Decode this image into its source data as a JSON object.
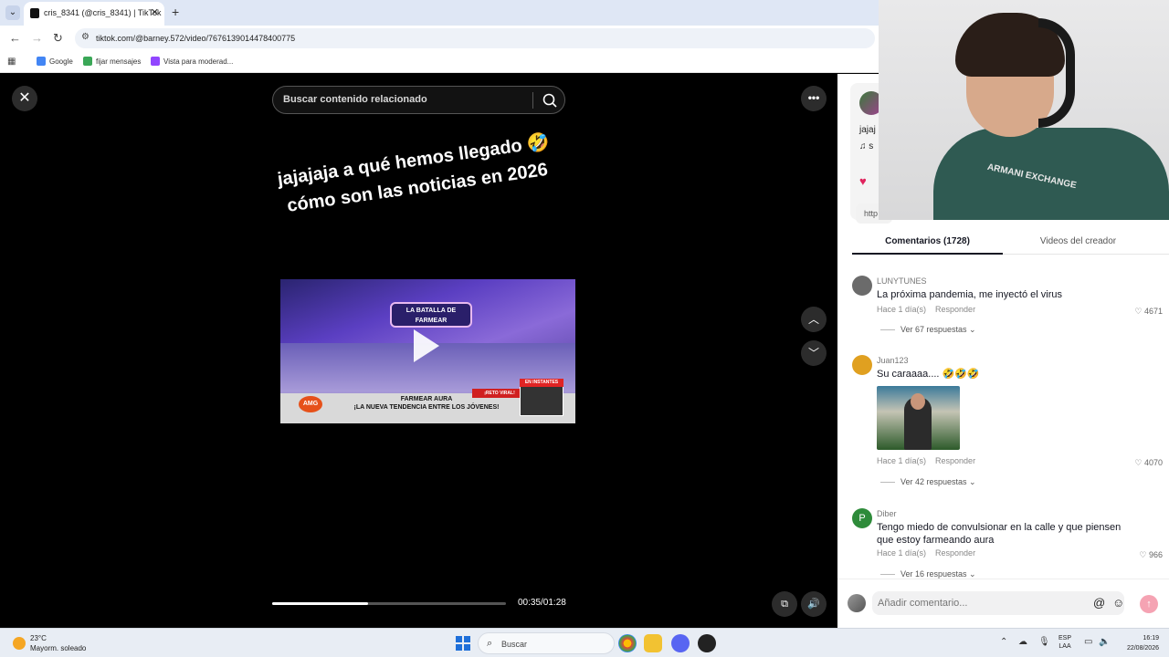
{
  "browser": {
    "tab_title": "cris_8341 (@cris_8341) | TikTok",
    "url": "tiktok.com/@barney.572/video/7676139014478400775",
    "bookmarks": [
      "Google",
      "fijar mensajes",
      "Vista para moderad..."
    ]
  },
  "video": {
    "search_placeholder": "Buscar contenido relacionado",
    "caption": "jajajaja a qué hemos llegado 🤣 cómo son las noticias en 2026",
    "thumbnail": {
      "top_logo": "LA BATALLA DE FARMEAR",
      "banner_logo": "AMG",
      "banner_title_line1": "FARMEAR AURA",
      "banner_title_line2": "¡LA NUEVA TENDENCIA ENTRE LOS JÓVENES!",
      "badge": "EN INSTANTES",
      "reto": "¡RETO VIRAL!"
    },
    "progress_fraction": 0.41,
    "time": "00:35/01:28"
  },
  "panel": {
    "desc_partial": "jajaj",
    "music_partial": "♫ s",
    "link_partial": "http",
    "tabs": [
      "Comentarios (1728)",
      "Videos del creador"
    ],
    "comments": [
      {
        "user": "LUNYTUNES",
        "text": "La próxima pandemia, me inyectó el virus",
        "time": "Hace 1 día(s)",
        "reply": "Responder",
        "likes": "4671",
        "replies": "Ver 67 respuestas",
        "avatar_color": "#6b6b6b",
        "avatar_letter": ""
      },
      {
        "user": "Juan123",
        "text": "Su caraaaa.... 🤣🤣🤣",
        "time": "Hace 1 día(s)",
        "reply": "Responder",
        "likes": "4070",
        "replies": "Ver 42 respuestas",
        "avatar_color": "#e0a020",
        "avatar_letter": ""
      },
      {
        "user": "Diber",
        "text": "Tengo miedo de convulsionar en la calle y que piensen que estoy farmeando aura",
        "time": "Hace 1 día(s)",
        "reply": "Responder",
        "likes": "966",
        "replies": "Ver 16 respuestas",
        "avatar_color": "#2e8b3a",
        "avatar_letter": "P"
      }
    ],
    "composer_placeholder": "Añadir comentario..."
  },
  "webcam": {
    "shirt_logo": "ARMANI EXCHANGE"
  },
  "taskbar": {
    "temp": "23°C",
    "weather": "Mayorm. soleado",
    "search": "Buscar",
    "lang_line1": "ESP",
    "lang_line2": "LAA",
    "time": "16:19",
    "date": "22/08/2026"
  }
}
